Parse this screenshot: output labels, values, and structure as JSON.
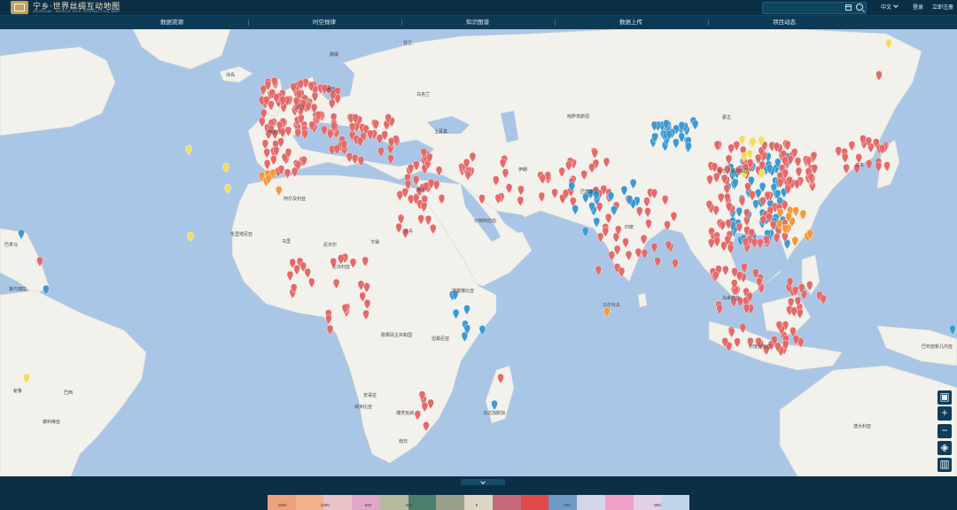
{
  "header": {
    "title": "宁乡·世界丝绸互动地图",
    "subtitle": "JIUSHOW · WORLD SILK INTERACTIVE MAP",
    "language": "中文",
    "login": "登录",
    "register": "立即注册"
  },
  "nav": [
    {
      "label": "数据资源"
    },
    {
      "label": "时空规律"
    },
    {
      "label": "知识图谱"
    },
    {
      "label": "数据上传"
    },
    {
      "label": "项目动态"
    }
  ],
  "map": {
    "labels": [
      {
        "text": "冰岛",
        "kind": "country"
      },
      {
        "text": "挪威",
        "kind": "country"
      },
      {
        "text": "芬兰",
        "kind": "country"
      },
      {
        "text": "德国",
        "kind": "country"
      },
      {
        "text": "法国",
        "kind": "country"
      },
      {
        "text": "西班牙",
        "kind": "country"
      },
      {
        "text": "乌克兰",
        "kind": "country"
      },
      {
        "text": "土耳其",
        "kind": "country"
      },
      {
        "text": "埃及",
        "kind": "country"
      },
      {
        "text": "沙特阿拉伯",
        "kind": "country"
      },
      {
        "text": "伊朗",
        "kind": "country"
      },
      {
        "text": "哈萨克斯坦",
        "kind": "country"
      },
      {
        "text": "蒙古",
        "kind": "country"
      },
      {
        "text": "中华人民共和国",
        "kind": "country"
      },
      {
        "text": "印度",
        "kind": "country"
      },
      {
        "text": "巴基斯坦",
        "kind": "country"
      },
      {
        "text": "日本",
        "kind": "country"
      },
      {
        "text": "阿尔及利亚",
        "kind": "country"
      },
      {
        "text": "马里",
        "kind": "country"
      },
      {
        "text": "尼日尔",
        "kind": "country"
      },
      {
        "text": "乍得",
        "kind": "country"
      },
      {
        "text": "苏丹",
        "kind": "country"
      },
      {
        "text": "尼日利亚",
        "kind": "country"
      },
      {
        "text": "埃塞俄比亚",
        "kind": "country"
      },
      {
        "text": "刚果民主共和国",
        "kind": "country"
      },
      {
        "text": "坦桑尼亚",
        "kind": "country"
      },
      {
        "text": "安哥拉",
        "kind": "country"
      },
      {
        "text": "纳米比亚",
        "kind": "country"
      },
      {
        "text": "博茨瓦纳",
        "kind": "country"
      },
      {
        "text": "南非",
        "kind": "country"
      },
      {
        "text": "马达加斯加",
        "kind": "country"
      },
      {
        "text": "巴西",
        "kind": "country"
      },
      {
        "text": "秘鲁",
        "kind": "country"
      },
      {
        "text": "玻利维亚",
        "kind": "country"
      },
      {
        "text": "委内瑞拉",
        "kind": "country"
      },
      {
        "text": "澳大利亚",
        "kind": "country"
      },
      {
        "text": "巴布亚新几内亚",
        "kind": "country"
      },
      {
        "text": "印度尼西亚",
        "kind": "country"
      },
      {
        "text": "马来西亚",
        "kind": "country"
      },
      {
        "text": "毛里塔尼亚",
        "kind": "country"
      },
      {
        "text": "巴拿马",
        "kind": "country"
      },
      {
        "text": "马尔代夫",
        "kind": "country"
      }
    ],
    "colors": {
      "ocean": "#a9c6e6",
      "land": "#f2f1eb",
      "pin_red": "#e46a6a",
      "pin_blue": "#3d9ad1",
      "pin_yellow": "#f3de5a",
      "pin_orange": "#f29a3a"
    }
  },
  "tools": [
    {
      "icon": "info-icon"
    },
    {
      "icon": "zoom-in-icon"
    },
    {
      "icon": "zoom-out-icon"
    },
    {
      "icon": "layers-icon"
    },
    {
      "icon": "chart-icon"
    }
  ],
  "legend": {
    "ticks": [
      "-1600",
      "-1200",
      "-800",
      "-400",
      "0",
      "400",
      "800"
    ],
    "colors": [
      "#f0a17b",
      "#f3b48d",
      "#e9c3c8",
      "#e0a8c8",
      "#b7b99c",
      "#4b7f6b",
      "#9aa18a",
      "#dcd6c4",
      "#c46a78",
      "#e24a4a",
      "#6e9ac4",
      "#d3d6e8",
      "#f2a1c6",
      "#e3cfe6",
      "#bfd5ec"
    ]
  }
}
